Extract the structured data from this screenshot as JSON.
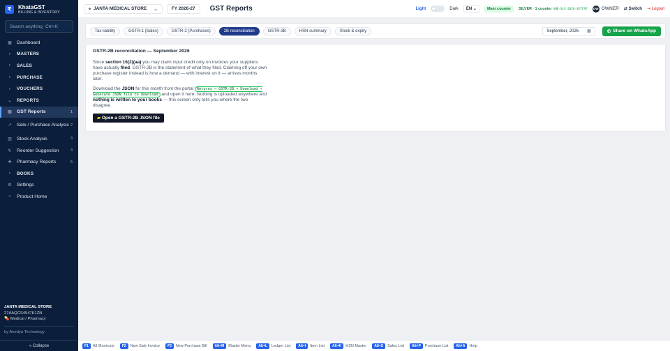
{
  "app": {
    "name": "KhataGST",
    "subtitle": "BILLING & INVENTORY",
    "logo_glyph": "₹"
  },
  "sidebar": {
    "search_placeholder": "Search anything",
    "search_shortcut": "Ctrl+K",
    "items": [
      {
        "label": "Dashboard",
        "icon": "▦",
        "type": "item"
      },
      {
        "label": "MASTERS",
        "icon": "›",
        "type": "section"
      },
      {
        "label": "SALES",
        "icon": "›",
        "type": "section"
      },
      {
        "label": "PURCHASE",
        "icon": "›",
        "type": "section"
      },
      {
        "label": "VOUCHERS",
        "icon": "›",
        "type": "section"
      },
      {
        "label": "REPORTS",
        "icon": "⌄",
        "type": "section"
      },
      {
        "label": "GST Reports",
        "icon": "▤",
        "count": "1",
        "type": "active"
      },
      {
        "label": "Sale / Purchase Analysis",
        "icon": "↗",
        "count": "2",
        "type": "two"
      },
      {
        "label": "Stock Analysis",
        "icon": "▥",
        "count": "3",
        "type": "item"
      },
      {
        "label": "Reorder Suggestion",
        "icon": "↻",
        "count": "4",
        "type": "item"
      },
      {
        "label": "Pharmacy Reports",
        "icon": "✚",
        "count": "5",
        "type": "item"
      },
      {
        "label": "BOOKS",
        "icon": "›",
        "type": "section"
      },
      {
        "label": "Settings",
        "icon": "⚙",
        "type": "item"
      },
      {
        "label": "Product Home",
        "icon": "⌂",
        "type": "item"
      }
    ],
    "store_name": "JANTA MEDICAL STORE",
    "gstin": "27AAQCS4547K1ZN",
    "store_type": "Medical / Pharmacy",
    "by": "by Anedya Technology",
    "collapse_label": "« Collapse"
  },
  "topbar": {
    "store": "JANTA MEDICAL STORE",
    "fy": "FY 2026-27",
    "page_title": "GST Reports",
    "theme_light": "Light",
    "theme_dark": "Dark",
    "lang": "EN",
    "counter": "Main counter",
    "license": "SILVER · 1 counter",
    "license_code": "ANB-SLV-2026-4E7F97",
    "user_initials": "OW",
    "role": "OWNER",
    "switch_label": "⇄ Switch",
    "logout_label": "⇥ Logout"
  },
  "tabs": [
    {
      "label": "Tax liability"
    },
    {
      "label": "GSTR-1 (Sales)"
    },
    {
      "label": "GSTR-2 (Purchases)"
    },
    {
      "label": "2B reconciliation",
      "active": true
    },
    {
      "label": "GSTR-3B"
    },
    {
      "label": "HSN summary"
    },
    {
      "label": "Stock & expiry"
    }
  ],
  "month": "September, 2026",
  "whatsapp_label": "Share on WhatsApp",
  "card": {
    "title": "GSTR-2B reconciliation — September 2026",
    "p1_a": "Since ",
    "p1_b": "section 16(2)(aa)",
    "p1_c": " you may claim input credit only on invoices your suppliers have actually ",
    "p1_d": "filed",
    "p1_e": ". GSTR-2B is the statement of what they filed. Claiming off your own purchase register instead is how a demand — with interest on it — arrives months later.",
    "p2_a": "Download the ",
    "p2_b": "JSON",
    "p2_c": " for this month from the portal ",
    "p2_path": "Returns → GSTR-2B → Download → Generate JSON file to download",
    "p2_d": " and open it here. Nothing is uploaded anywhere and ",
    "p2_e": "nothing is written to your books",
    "p2_f": " — this screen only tells you where the two disagree.",
    "button": "Open a GSTR-2B JSON file"
  },
  "shortcuts": [
    {
      "key": "F1",
      "label": "All Shortcuts"
    },
    {
      "key": "F2",
      "label": "New Sale Invoice"
    },
    {
      "key": "F3",
      "label": "New Purchase Bill"
    },
    {
      "key": "Alt+M",
      "label": "Master Menu"
    },
    {
      "key": "Alt+L",
      "label": "Ledger List"
    },
    {
      "key": "Alt+I",
      "label": "Item List"
    },
    {
      "key": "Alt+H",
      "label": "HSN Master"
    },
    {
      "key": "Alt+S",
      "label": "Sales List"
    },
    {
      "key": "Alt+P",
      "label": "Purchase List"
    },
    {
      "key": "Alt+A",
      "label": "Help"
    }
  ],
  "colors": {
    "sidebar": "#0b1e3b",
    "accent": "#2563eb",
    "whatsapp": "#16a34a",
    "active_tab": "#1e3a8a"
  }
}
